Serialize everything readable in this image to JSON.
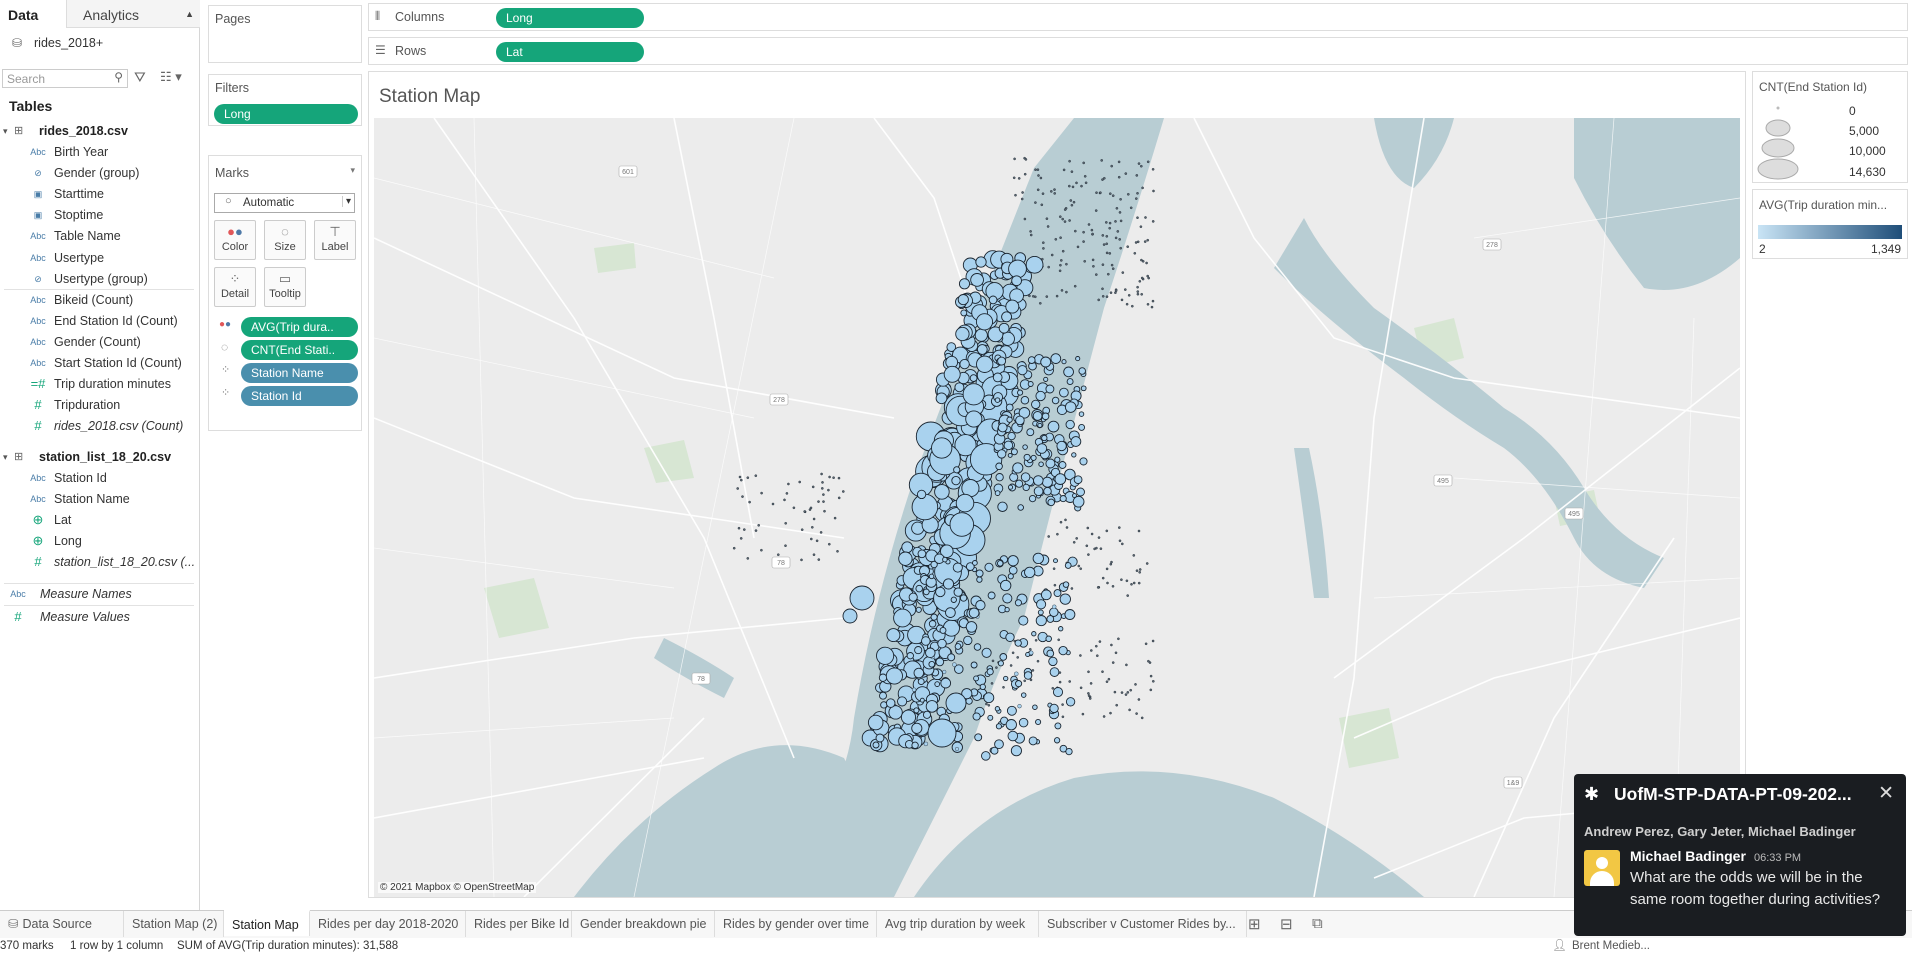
{
  "sidebar": {
    "tab_data": "Data",
    "tab_analytics": "Analytics",
    "datasource": "rides_2018+",
    "search_placeholder": "Search",
    "tables_heading": "Tables",
    "table1": {
      "name": "rides_2018.csv",
      "fields": [
        {
          "type": "Abc",
          "label": "Birth Year"
        },
        {
          "type": "paperclip",
          "label": "Gender (group)"
        },
        {
          "type": "date",
          "label": "Starttime"
        },
        {
          "type": "date",
          "label": "Stoptime"
        },
        {
          "type": "Abc",
          "label": "Table Name"
        },
        {
          "type": "Abc",
          "label": "Usertype"
        },
        {
          "type": "paperclip",
          "label": "Usertype (group)"
        },
        {
          "type": "Abc",
          "label": "Bikeid (Count)"
        },
        {
          "type": "Abc",
          "label": "End Station Id (Count)"
        },
        {
          "type": "Abc",
          "label": "Gender (Count)"
        },
        {
          "type": "Abc",
          "label": "Start Station Id (Count)"
        },
        {
          "type": "calc",
          "label": "Trip duration minutes"
        },
        {
          "type": "#",
          "label": "Tripduration"
        },
        {
          "type": "#",
          "label": "rides_2018.csv (Count)"
        }
      ]
    },
    "table2": {
      "name": "station_list_18_20.csv",
      "fields": [
        {
          "type": "Abc",
          "label": "Station Id"
        },
        {
          "type": "Abc",
          "label": "Station Name"
        },
        {
          "type": "globe",
          "label": "Lat"
        },
        {
          "type": "globe",
          "label": "Long"
        },
        {
          "type": "#",
          "label": "station_list_18_20.csv (..."
        }
      ]
    },
    "measure_names": "Measure Names",
    "measure_values": "Measure Values"
  },
  "shelves": {
    "pages": "Pages",
    "filters": "Filters",
    "filter_pill": "Long",
    "columns_label": "Columns",
    "columns_pill": "Long",
    "rows_label": "Rows",
    "rows_pill": "Lat"
  },
  "marks": {
    "title": "Marks",
    "type": "Automatic",
    "buttons": {
      "color": "Color",
      "size": "Size",
      "label": "Label",
      "detail": "Detail",
      "tooltip": "Tooltip"
    },
    "pills": [
      "AVG(Trip dura..",
      "CNT(End Stati..",
      "Station Name",
      "Station Id"
    ]
  },
  "view": {
    "title": "Station Map",
    "attribution": "© 2021 Mapbox © OpenStreetMap",
    "highway_labels": [
      "601",
      "278",
      "495",
      "278",
      "78",
      "78",
      "1&9",
      "495"
    ]
  },
  "legend_size": {
    "title": "CNT(End Station Id)",
    "items": [
      "0",
      "5,000",
      "10,000",
      "14,630"
    ]
  },
  "legend_color": {
    "title": "AVG(Trip duration min...",
    "min": "2",
    "max": "1,349",
    "color_low": "#c9e4f5",
    "color_high": "#1f4e79"
  },
  "tabs": {
    "data_source": "Data Source",
    "sheets": [
      "Station Map (2)",
      "Station Map",
      "Rides per day 2018-2020",
      "Rides per Bike Id",
      "Gender breakdown pie",
      "Rides by gender over time",
      "Avg trip duration by  week",
      "Subscriber v Customer Rides by..."
    ],
    "active": "Station Map"
  },
  "status": {
    "marks": "370 marks",
    "rows_cols": "1 row by 1 column",
    "sum": "SUM of AVG(Trip duration minutes): 31,588",
    "user": "Brent Medieb..."
  },
  "notification": {
    "channel": "UofM-STP-DATA-PT-09-202...",
    "participants": "Andrew Perez, Gary Jeter, Michael Badinger",
    "sender": "Michael Badinger",
    "time": "06:33 PM",
    "message": "What are the odds we will be in the same room together during activities?"
  },
  "colors": {
    "accent_green": "#15a57a",
    "pill_blue": "#4a8fad",
    "map_water": "#b8cdd3",
    "map_land": "#ececec",
    "bubble_fill": "#a9d2ee"
  }
}
